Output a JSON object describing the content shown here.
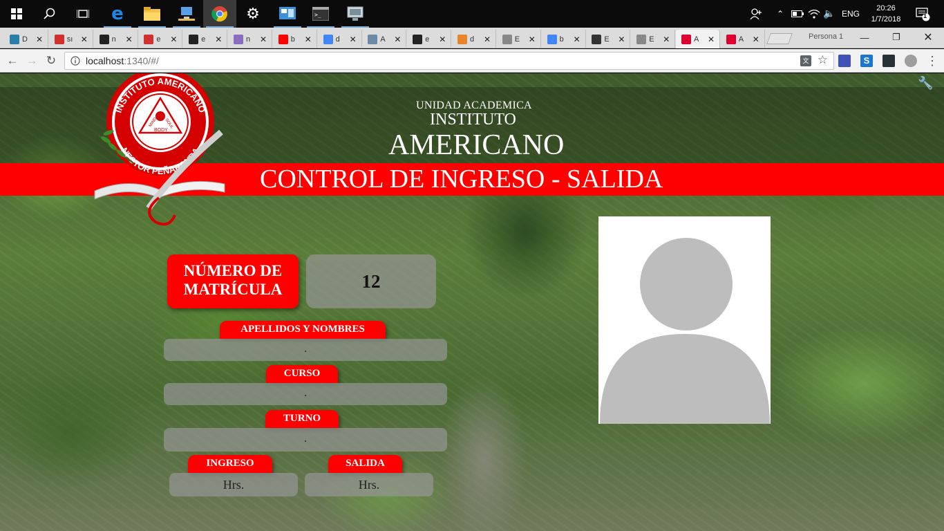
{
  "taskbar": {
    "language": "ENG",
    "time": "20:26",
    "date": "1/7/2018",
    "notification_count": "1"
  },
  "browser": {
    "tabs": [
      {
        "label": "D",
        "color": "#2a7fa8"
      },
      {
        "label": "sı",
        "color": "#d32f2f"
      },
      {
        "label": "n",
        "color": "#222222"
      },
      {
        "label": "e",
        "color": "#d32f2f"
      },
      {
        "label": "e",
        "color": "#222222"
      },
      {
        "label": "n",
        "color": "#8a6dbf"
      },
      {
        "label": "b",
        "color": "#ff0000"
      },
      {
        "label": "d",
        "color": "#4285f4"
      },
      {
        "label": "A",
        "color": "#6b8aa5"
      },
      {
        "label": "e",
        "color": "#222222"
      },
      {
        "label": "d",
        "color": "#e8842b"
      },
      {
        "label": "E",
        "color": "#888888"
      },
      {
        "label": "b",
        "color": "#4285f4"
      },
      {
        "label": "E",
        "color": "#333333"
      },
      {
        "label": "E",
        "color": "#888888"
      },
      {
        "label": "A",
        "color": "#dd0031"
      },
      {
        "label": "A",
        "color": "#dd0031"
      }
    ],
    "profile": "Persona 1",
    "url_host": "localhost",
    "url_path": ":1340/#/"
  },
  "header": {
    "unidad": "UNIDAD ACADEMICA",
    "instituto": "INSTITUTO",
    "americano": "AMERICANO",
    "banner": "CONTROL DE INGRESO - SALIDA",
    "logo": {
      "ring_top": "INSTITUTO AMERICANO",
      "ring_bottom": "NESTOR PEÑARANDA",
      "mind": "MIND",
      "soul": "SOUL",
      "body": "BODY"
    }
  },
  "form": {
    "matricula_label": "NÚMERO DE MATRÍCULA",
    "matricula_value": "12",
    "nombres_label": "APELLIDOS Y NOMBRES",
    "nombres_value": ".",
    "curso_label": "CURSO",
    "curso_value": ".",
    "turno_label": "TURNO",
    "turno_value": ".",
    "ingreso_label": "INGRESO",
    "ingreso_value": "Hrs.",
    "salida_label": "SALIDA",
    "salida_value": "Hrs."
  },
  "colors": {
    "accent_red": "#ff0000",
    "field_gray": "#969696"
  }
}
